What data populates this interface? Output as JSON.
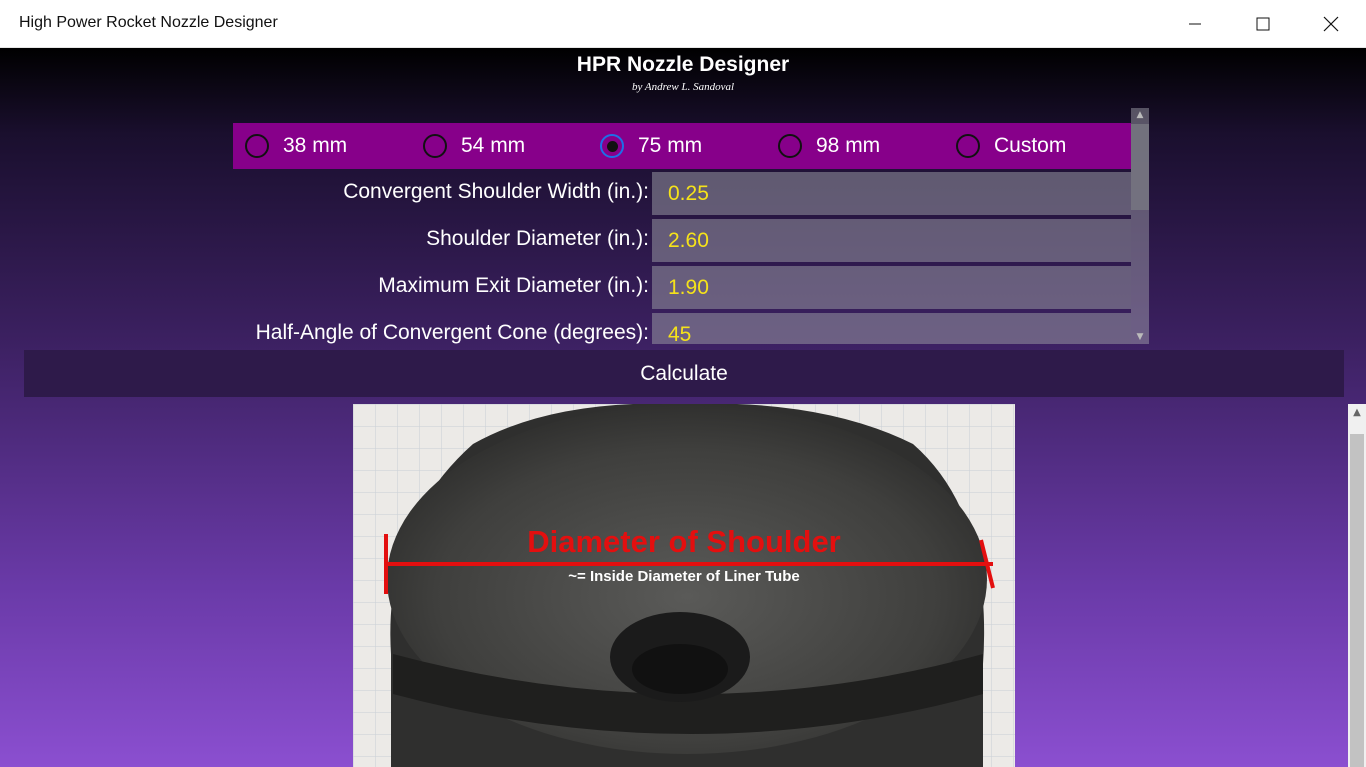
{
  "window": {
    "title": "High Power Rocket Nozzle Designer",
    "controls": [
      "minimize-icon",
      "maximize-icon",
      "close-icon"
    ]
  },
  "header": {
    "title": "HPR Nozzle Designer",
    "subtitle": "by Andrew L. Sandoval"
  },
  "motor_size": {
    "options": [
      {
        "label": "38 mm",
        "checked": false
      },
      {
        "label": "54 mm",
        "checked": false
      },
      {
        "label": "75 mm",
        "checked": true
      },
      {
        "label": "98 mm",
        "checked": false
      },
      {
        "label": "Custom",
        "checked": false
      }
    ]
  },
  "fields": [
    {
      "label": "Convergent Shoulder Width (in.):",
      "value": "0.25"
    },
    {
      "label": "Shoulder Diameter (in.):",
      "value": "2.60"
    },
    {
      "label": "Maximum Exit Diameter (in.):",
      "value": "1.90"
    },
    {
      "label": "Half-Angle of Convergent Cone (degrees):",
      "value": "45"
    }
  ],
  "calculate": {
    "label": "Calculate"
  },
  "diagram": {
    "title": "Diameter of Shoulder",
    "caption": "~= Inside Diameter of Liner Tube"
  },
  "colors": {
    "radio_bar": "#87008a",
    "input_text": "#f5e21a",
    "calc_button": "#2e1a4a",
    "annotation_red": "#e30f0f"
  }
}
